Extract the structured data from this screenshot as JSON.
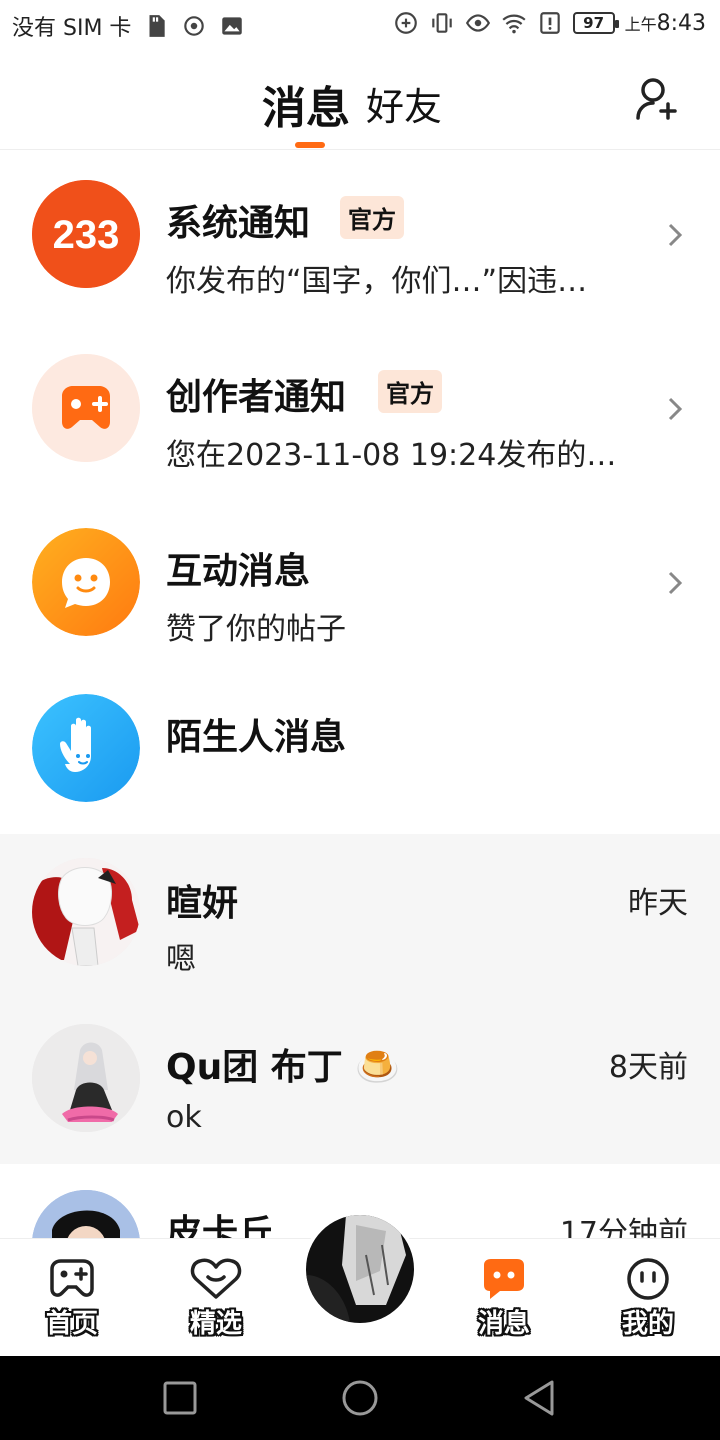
{
  "status_bar": {
    "carrier": "没有 SIM 卡",
    "battery": "97",
    "time_prefix": "上午",
    "time": "8:43"
  },
  "header": {
    "tab_messages": "消息",
    "tab_friends": "好友",
    "accent_color": "#ff6a13"
  },
  "notifications": [
    {
      "title": "系统通知",
      "badge": "官方",
      "subtitle": "你发布的“国字，你们…”因违…",
      "icon": "233-logo-icon"
    },
    {
      "title": "创作者通知",
      "badge": "官方",
      "subtitle": "您在2023-11-08 19:24发布的…",
      "icon": "gamepad-icon"
    },
    {
      "title": "互动消息",
      "subtitle": "赞了你的帖子",
      "icon": "chat-bubble-icon"
    },
    {
      "title": "陌生人消息",
      "icon": "waving-hand-icon"
    }
  ],
  "chats": [
    {
      "name": "暄妍",
      "message": "嗯",
      "time": "昨天"
    },
    {
      "name": "Qu团 布丁",
      "emoji": "🍮",
      "message": "ok",
      "time": "8天前"
    },
    {
      "name": "皮卡丘",
      "time": "17分钟前"
    }
  ],
  "bottom_nav": {
    "home": "首页",
    "featured": "精选",
    "messages": "消息",
    "mine": "我的"
  }
}
